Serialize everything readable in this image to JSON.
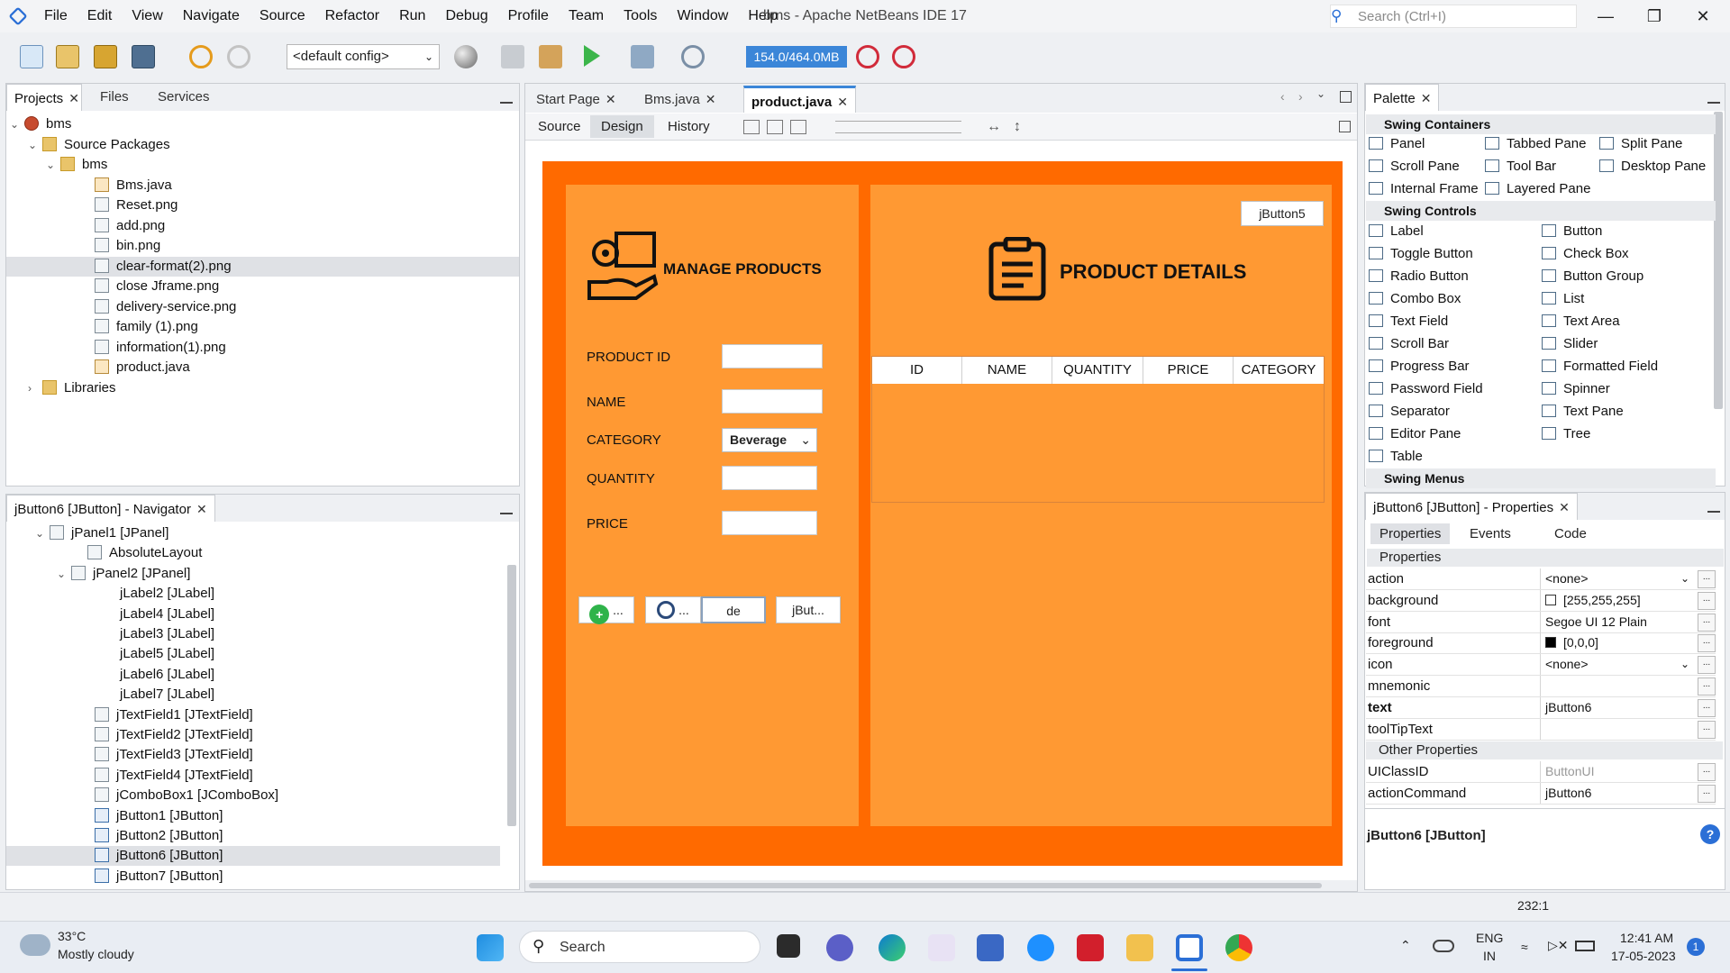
{
  "window": {
    "title": "bms - Apache NetBeans IDE 17"
  },
  "menu": [
    "File",
    "Edit",
    "View",
    "Navigate",
    "Source",
    "Refactor",
    "Run",
    "Debug",
    "Profile",
    "Team",
    "Tools",
    "Window",
    "Help"
  ],
  "search": {
    "placeholder": "Search (Ctrl+I)"
  },
  "toolbar": {
    "config": "<default config>",
    "memory": "154.0/464.0MB"
  },
  "projects_panel": {
    "tabs": [
      "Projects",
      "Files",
      "Services"
    ],
    "tree": [
      {
        "label": "bms",
        "icon": "project-icon"
      },
      {
        "label": "Source Packages",
        "icon": "folder-icon"
      },
      {
        "label": "bms",
        "icon": "package-icon"
      },
      {
        "label": "Bms.java",
        "icon": "java-file-icon"
      },
      {
        "label": "Reset.png",
        "icon": "image-file-icon"
      },
      {
        "label": "add.png",
        "icon": "image-file-icon"
      },
      {
        "label": "bin.png",
        "icon": "image-file-icon"
      },
      {
        "label": "clear-format(2).png",
        "icon": "image-file-icon"
      },
      {
        "label": "close Jframe.png",
        "icon": "image-file-icon"
      },
      {
        "label": "delivery-service.png",
        "icon": "image-file-icon"
      },
      {
        "label": "family (1).png",
        "icon": "image-file-icon"
      },
      {
        "label": "information(1).png",
        "icon": "image-file-icon"
      },
      {
        "label": "product.java",
        "icon": "java-file-icon"
      },
      {
        "label": "Libraries",
        "icon": "folder-icon"
      }
    ]
  },
  "navigator": {
    "title": "jButton6 [JButton] - Navigator",
    "tree": [
      "jPanel1 [JPanel]",
      "AbsoluteLayout",
      "jPanel2 [JPanel]",
      "jLabel2 [JLabel]",
      "jLabel4 [JLabel]",
      "jLabel3 [JLabel]",
      "jLabel5 [JLabel]",
      "jLabel6 [JLabel]",
      "jLabel7 [JLabel]",
      "jTextField1 [JTextField]",
      "jTextField2 [JTextField]",
      "jTextField3 [JTextField]",
      "jTextField4 [JTextField]",
      "jComboBox1 [JComboBox]",
      "jButton1 [JButton]",
      "jButton2 [JButton]",
      "jButton6 [JButton]",
      "jButton7 [JButton]"
    ]
  },
  "editor": {
    "tabs": [
      "Start Page",
      "Bms.java",
      "product.java"
    ],
    "subtabs": [
      "Source",
      "Design",
      "History"
    ]
  },
  "form": {
    "manage_title": "MANAGE PRODUCTS",
    "details_title": "PRODUCT DETAILS",
    "labels": [
      "PRODUCT ID",
      "NAME",
      "CATEGORY",
      "QUANTITY",
      "PRICE"
    ],
    "category_value": "Beverage",
    "jbutton5": "jButton5",
    "buttons": [
      "...",
      "...",
      "de",
      "jBut..."
    ],
    "table_headers": [
      "ID",
      "NAME",
      "QUANTITY",
      "PRICE",
      "CATEGORY"
    ]
  },
  "palette": {
    "title": "Palette",
    "sections": [
      "Swing Containers",
      "Swing Controls",
      "Swing Menus"
    ],
    "containers": [
      "Panel",
      "Tabbed Pane",
      "Split Pane",
      "Scroll Pane",
      "Tool Bar",
      "Desktop Pane",
      "Internal Frame",
      "Layered Pane"
    ],
    "controls": [
      "Label",
      "Button",
      "Toggle Button",
      "Check Box",
      "Radio Button",
      "Button Group",
      "Combo Box",
      "List",
      "Text Field",
      "Text Area",
      "Scroll Bar",
      "Slider",
      "Progress Bar",
      "Formatted Field",
      "Password Field",
      "Spinner",
      "Separator",
      "Text Pane",
      "Editor Pane",
      "Tree",
      "Table"
    ]
  },
  "properties": {
    "title": "jButton6 [JButton] - Properties",
    "tabs": [
      "Properties",
      "Events",
      "Code"
    ],
    "section": "Properties",
    "rows": [
      {
        "name": "action",
        "value": "<none>"
      },
      {
        "name": "background",
        "value": "[255,255,255]"
      },
      {
        "name": "font",
        "value": "Segoe UI 12 Plain"
      },
      {
        "name": "foreground",
        "value": "[0,0,0]"
      },
      {
        "name": "icon",
        "value": "<none>"
      },
      {
        "name": "mnemonic",
        "value": ""
      },
      {
        "name": "text",
        "value": "jButton6"
      },
      {
        "name": "toolTipText",
        "value": ""
      }
    ],
    "other_section": "Other Properties",
    "other_rows": [
      {
        "name": "UIClassID",
        "value": "ButtonUI"
      },
      {
        "name": "actionCommand",
        "value": "jButton6"
      }
    ],
    "footer": "jButton6 [JButton]"
  },
  "status": {
    "position": "232:1"
  },
  "taskbar": {
    "weather_temp": "33°C",
    "weather_desc": "Mostly cloudy",
    "search": "Search",
    "lang1": "ENG",
    "lang2": "IN",
    "time": "12:41 AM",
    "date": "17-05-2023",
    "notif": "1"
  },
  "colors": {
    "frame": "#ff6a00",
    "panel": "#ff9933",
    "accent": "#2b6fd6"
  }
}
